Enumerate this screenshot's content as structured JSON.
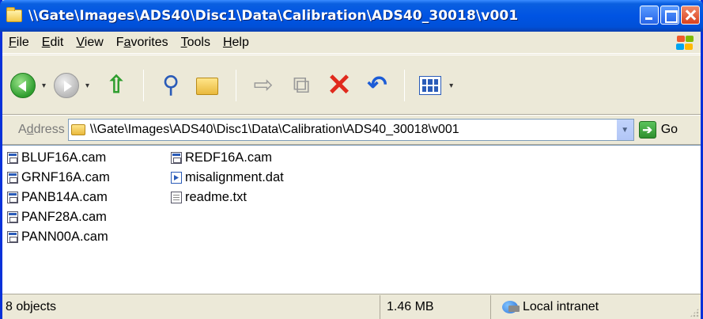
{
  "window": {
    "title": "\\\\Gate\\Images\\ADS40\\Disc1\\Data\\Calibration\\ADS40_30018\\v001"
  },
  "menu": {
    "items": [
      {
        "underline": "F",
        "rest": "ile"
      },
      {
        "underline": "E",
        "rest": "dit"
      },
      {
        "underline": "V",
        "rest": "iew"
      },
      {
        "pre": "F",
        "underline": "a",
        "rest": "vorites"
      },
      {
        "underline": "T",
        "rest": "ools"
      },
      {
        "underline": "H",
        "rest": "elp"
      }
    ]
  },
  "toolbar": {
    "buttons": [
      "back-icon",
      "forward-icon",
      "up-folder-icon",
      "search-icon",
      "folders-icon",
      "move-to-icon",
      "copy-to-icon",
      "delete-icon",
      "undo-icon",
      "views-icon"
    ]
  },
  "address": {
    "label_pre": "A",
    "label_under": "d",
    "label_rest": "dress",
    "value": "\\\\Gate\\Images\\ADS40\\Disc1\\Data\\Calibration\\ADS40_30018\\v001",
    "go_label": "Go"
  },
  "files": {
    "col1": [
      {
        "name": "BLUF16A.cam",
        "type": "cam"
      },
      {
        "name": "GRNF16A.cam",
        "type": "cam"
      },
      {
        "name": "PANB14A.cam",
        "type": "cam"
      },
      {
        "name": "PANF28A.cam",
        "type": "cam"
      },
      {
        "name": "PANN00A.cam",
        "type": "cam"
      }
    ],
    "col2": [
      {
        "name": "REDF16A.cam",
        "type": "cam"
      },
      {
        "name": "misalignment.dat",
        "type": "dat"
      },
      {
        "name": "readme.txt",
        "type": "txt"
      }
    ]
  },
  "status": {
    "objects": "8 objects",
    "size": "1.46 MB",
    "zone": "Local intranet"
  }
}
